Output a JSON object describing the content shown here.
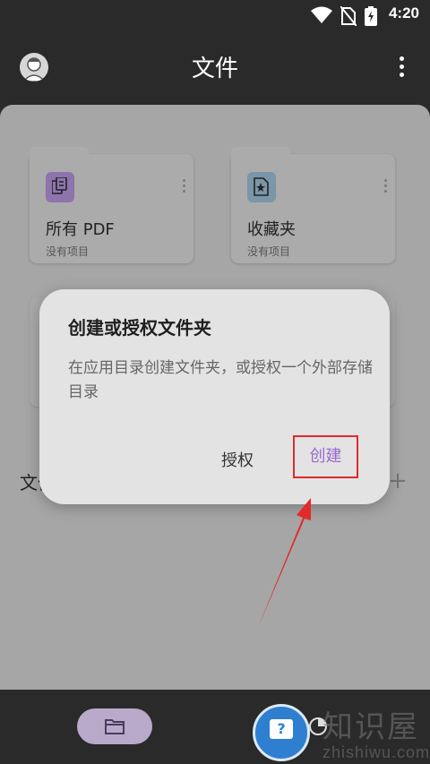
{
  "status_bar": {
    "time": "4:20",
    "icons": [
      "wifi-icon",
      "no-sim-icon",
      "battery-charging-icon"
    ]
  },
  "app_bar": {
    "title": "文件",
    "avatar_icon": "person-avatar-icon",
    "menu_icon": "more-vertical-icon"
  },
  "cards": [
    {
      "name": "所有 PDF",
      "subtitle": "没有项目",
      "icon": "pdf-documents-icon",
      "icon_color": "#8e74ad"
    },
    {
      "name": "收藏夹",
      "subtitle": "没有项目",
      "icon": "starred-document-icon",
      "icon_color": "#7b96a8"
    }
  ],
  "section": {
    "title_partial": "文件",
    "add_icon": "plus-icon"
  },
  "dialog": {
    "title": "创建或授权文件夹",
    "message": "在应用目录创建文件夹，或授权一个外部存储目录",
    "authorize_label": "授权",
    "create_label": "创建"
  },
  "bottom_nav": {
    "files_icon": "folder-icon",
    "recent_icon": "pie-chart-icon"
  },
  "watermark": {
    "cn": "知识屋",
    "en": "zhishiwu.com",
    "badge_glyph": "?"
  },
  "colors": {
    "accent": "#9b6ad1",
    "highlight_box": "#e32a2a",
    "arrow": "#e32a2a"
  }
}
